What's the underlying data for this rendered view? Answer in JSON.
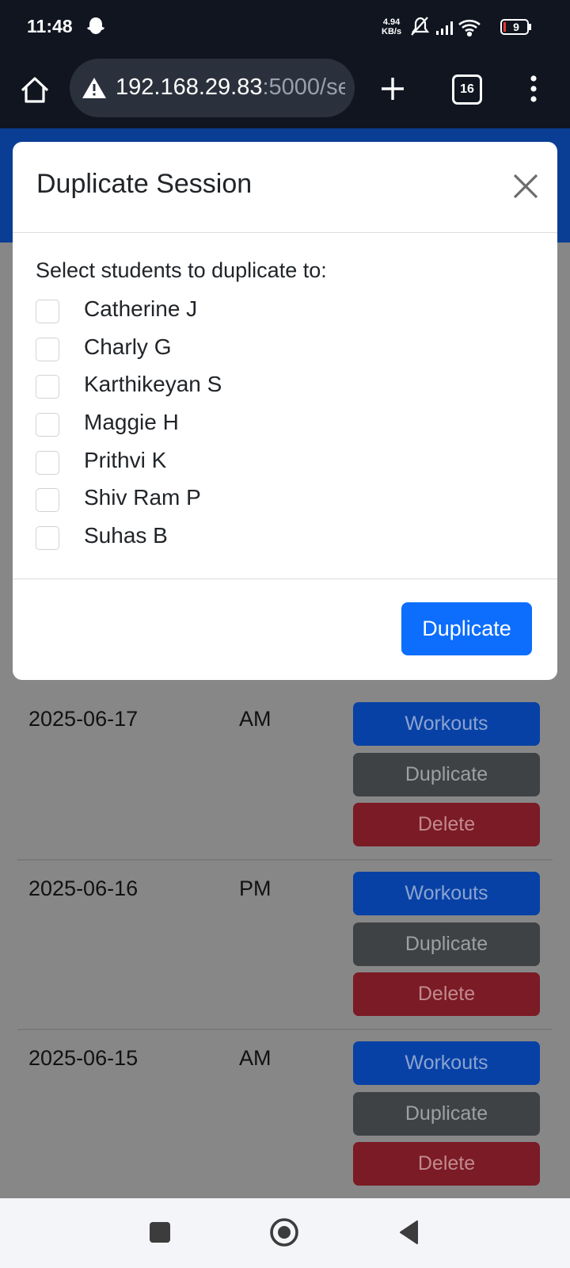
{
  "status_bar": {
    "time": "11:48",
    "net_speed_value": "4.94",
    "net_speed_unit": "KB/s",
    "battery": "9"
  },
  "browser": {
    "url_host": "192.168.29.83",
    "url_rest": ":5000/se",
    "tab_count": "16"
  },
  "modal": {
    "title": "Duplicate Session",
    "prompt": "Select students to duplicate to:",
    "students": [
      {
        "name": "Catherine J",
        "checked": false
      },
      {
        "name": "Charly G",
        "checked": false
      },
      {
        "name": "Karthikeyan S",
        "checked": false
      },
      {
        "name": "Maggie H",
        "checked": false
      },
      {
        "name": "Prithvi K",
        "checked": false
      },
      {
        "name": "Shiv Ram P",
        "checked": false
      },
      {
        "name": "Suhas B",
        "checked": false
      }
    ],
    "submit_label": "Duplicate"
  },
  "sessions": [
    {
      "date": "2025-06-17",
      "period": "AM",
      "workouts_label": "Workouts",
      "duplicate_label": "Duplicate",
      "delete_label": "Delete"
    },
    {
      "date": "2025-06-16",
      "period": "PM",
      "workouts_label": "Workouts",
      "duplicate_label": "Duplicate",
      "delete_label": "Delete"
    },
    {
      "date": "2025-06-15",
      "period": "AM",
      "workouts_label": "Workouts",
      "duplicate_label": "Duplicate",
      "delete_label": "Delete"
    }
  ],
  "colors": {
    "primary": "#0d6efd",
    "secondary": "#6c757d",
    "danger": "#dc3545",
    "overlay": "#878787"
  }
}
